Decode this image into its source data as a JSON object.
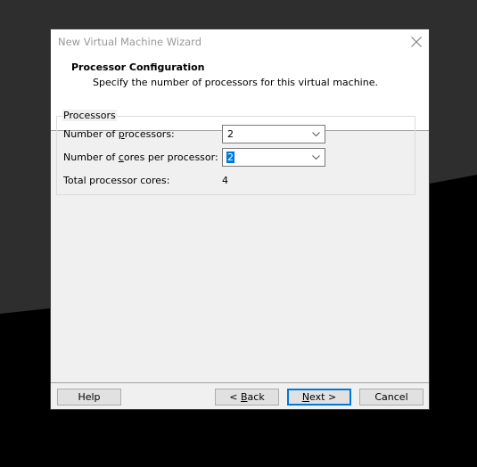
{
  "window": {
    "title": "New Virtual Machine Wizard",
    "close_icon": "close-icon"
  },
  "header": {
    "title": "Processor Configuration",
    "subtitle": "Specify the number of processors for this virtual machine."
  },
  "processors_group": {
    "legend": "Processors",
    "num_processors": {
      "label_pre": "Number of ",
      "label_accel": "p",
      "label_post": "rocessors:",
      "value": "2"
    },
    "cores_per_processor": {
      "label_pre": "Number of ",
      "label_accel": "c",
      "label_post": "ores per processor:",
      "value": "2"
    },
    "total_cores": {
      "label": "Total processor cores:",
      "value": "4"
    }
  },
  "buttons": {
    "help": "Help",
    "back_pre": "< ",
    "back_accel": "B",
    "back_post": "ack",
    "next_accel": "N",
    "next_post": "ext >",
    "cancel": "Cancel"
  },
  "colors": {
    "accent": "#0078d7",
    "dialog_bg": "#f0f0f0",
    "header_bg": "#ffffff"
  }
}
